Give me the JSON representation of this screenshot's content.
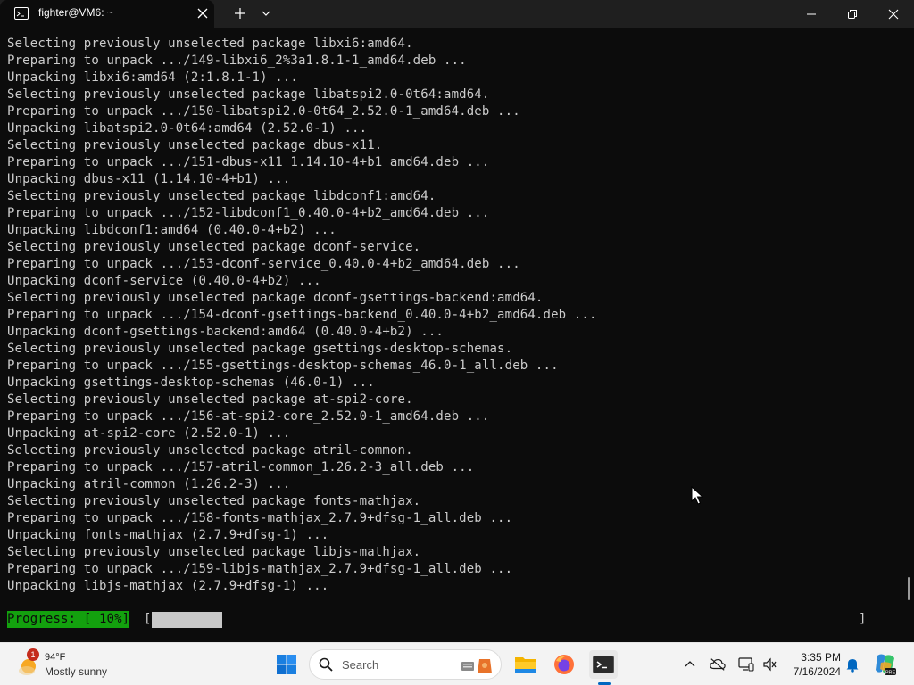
{
  "window": {
    "tab_title": "fighter@VM6: ~"
  },
  "terminal": {
    "lines": [
      "Selecting previously unselected package libxi6:amd64.",
      "Preparing to unpack .../149-libxi6_2%3a1.8.1-1_amd64.deb ...",
      "Unpacking libxi6:amd64 (2:1.8.1-1) ...",
      "Selecting previously unselected package libatspi2.0-0t64:amd64.",
      "Preparing to unpack .../150-libatspi2.0-0t64_2.52.0-1_amd64.deb ...",
      "Unpacking libatspi2.0-0t64:amd64 (2.52.0-1) ...",
      "Selecting previously unselected package dbus-x11.",
      "Preparing to unpack .../151-dbus-x11_1.14.10-4+b1_amd64.deb ...",
      "Unpacking dbus-x11 (1.14.10-4+b1) ...",
      "Selecting previously unselected package libdconf1:amd64.",
      "Preparing to unpack .../152-libdconf1_0.40.0-4+b2_amd64.deb ...",
      "Unpacking libdconf1:amd64 (0.40.0-4+b2) ...",
      "Selecting previously unselected package dconf-service.",
      "Preparing to unpack .../153-dconf-service_0.40.0-4+b2_amd64.deb ...",
      "Unpacking dconf-service (0.40.0-4+b2) ...",
      "Selecting previously unselected package dconf-gsettings-backend:amd64.",
      "Preparing to unpack .../154-dconf-gsettings-backend_0.40.0-4+b2_amd64.deb ...",
      "Unpacking dconf-gsettings-backend:amd64 (0.40.0-4+b2) ...",
      "Selecting previously unselected package gsettings-desktop-schemas.",
      "Preparing to unpack .../155-gsettings-desktop-schemas_46.0-1_all.deb ...",
      "Unpacking gsettings-desktop-schemas (46.0-1) ...",
      "Selecting previously unselected package at-spi2-core.",
      "Preparing to unpack .../156-at-spi2-core_2.52.0-1_amd64.deb ...",
      "Unpacking at-spi2-core (2.52.0-1) ...",
      "Selecting previously unselected package atril-common.",
      "Preparing to unpack .../157-atril-common_1.26.2-3_all.deb ...",
      "Unpacking atril-common (1.26.2-3) ...",
      "Selecting previously unselected package fonts-mathjax.",
      "Preparing to unpack .../158-fonts-mathjax_2.7.9+dfsg-1_all.deb ...",
      "Unpacking fonts-mathjax (2.7.9+dfsg-1) ...",
      "Selecting previously unselected package libjs-mathjax.",
      "Preparing to unpack .../159-libjs-mathjax_2.7.9+dfsg-1_all.deb ...",
      "Unpacking libjs-mathjax (2.7.9+dfsg-1) ..."
    ],
    "progress": {
      "label": "Progress: [ 10%]",
      "bracket_open": "[",
      "bracket_close": "]",
      "fraction": 0.1,
      "bar_color": "#13a10e"
    }
  },
  "taskbar": {
    "weather": {
      "badge": "1",
      "temp": "94°F",
      "desc": "Mostly sunny",
      "icon": "sun-cloud-icon"
    },
    "search_label": "Search",
    "clock": {
      "time": "3:35 PM",
      "date": "7/16/2024"
    },
    "pinned": [
      "windows-start-icon",
      "file-explorer-icon",
      "firefox-icon",
      "terminal-icon"
    ],
    "tray": [
      "chevron-up-icon",
      "onedrive-offline-icon",
      "display-icon",
      "sound-icon",
      "notification-bell-icon",
      "copilot-icon"
    ]
  }
}
